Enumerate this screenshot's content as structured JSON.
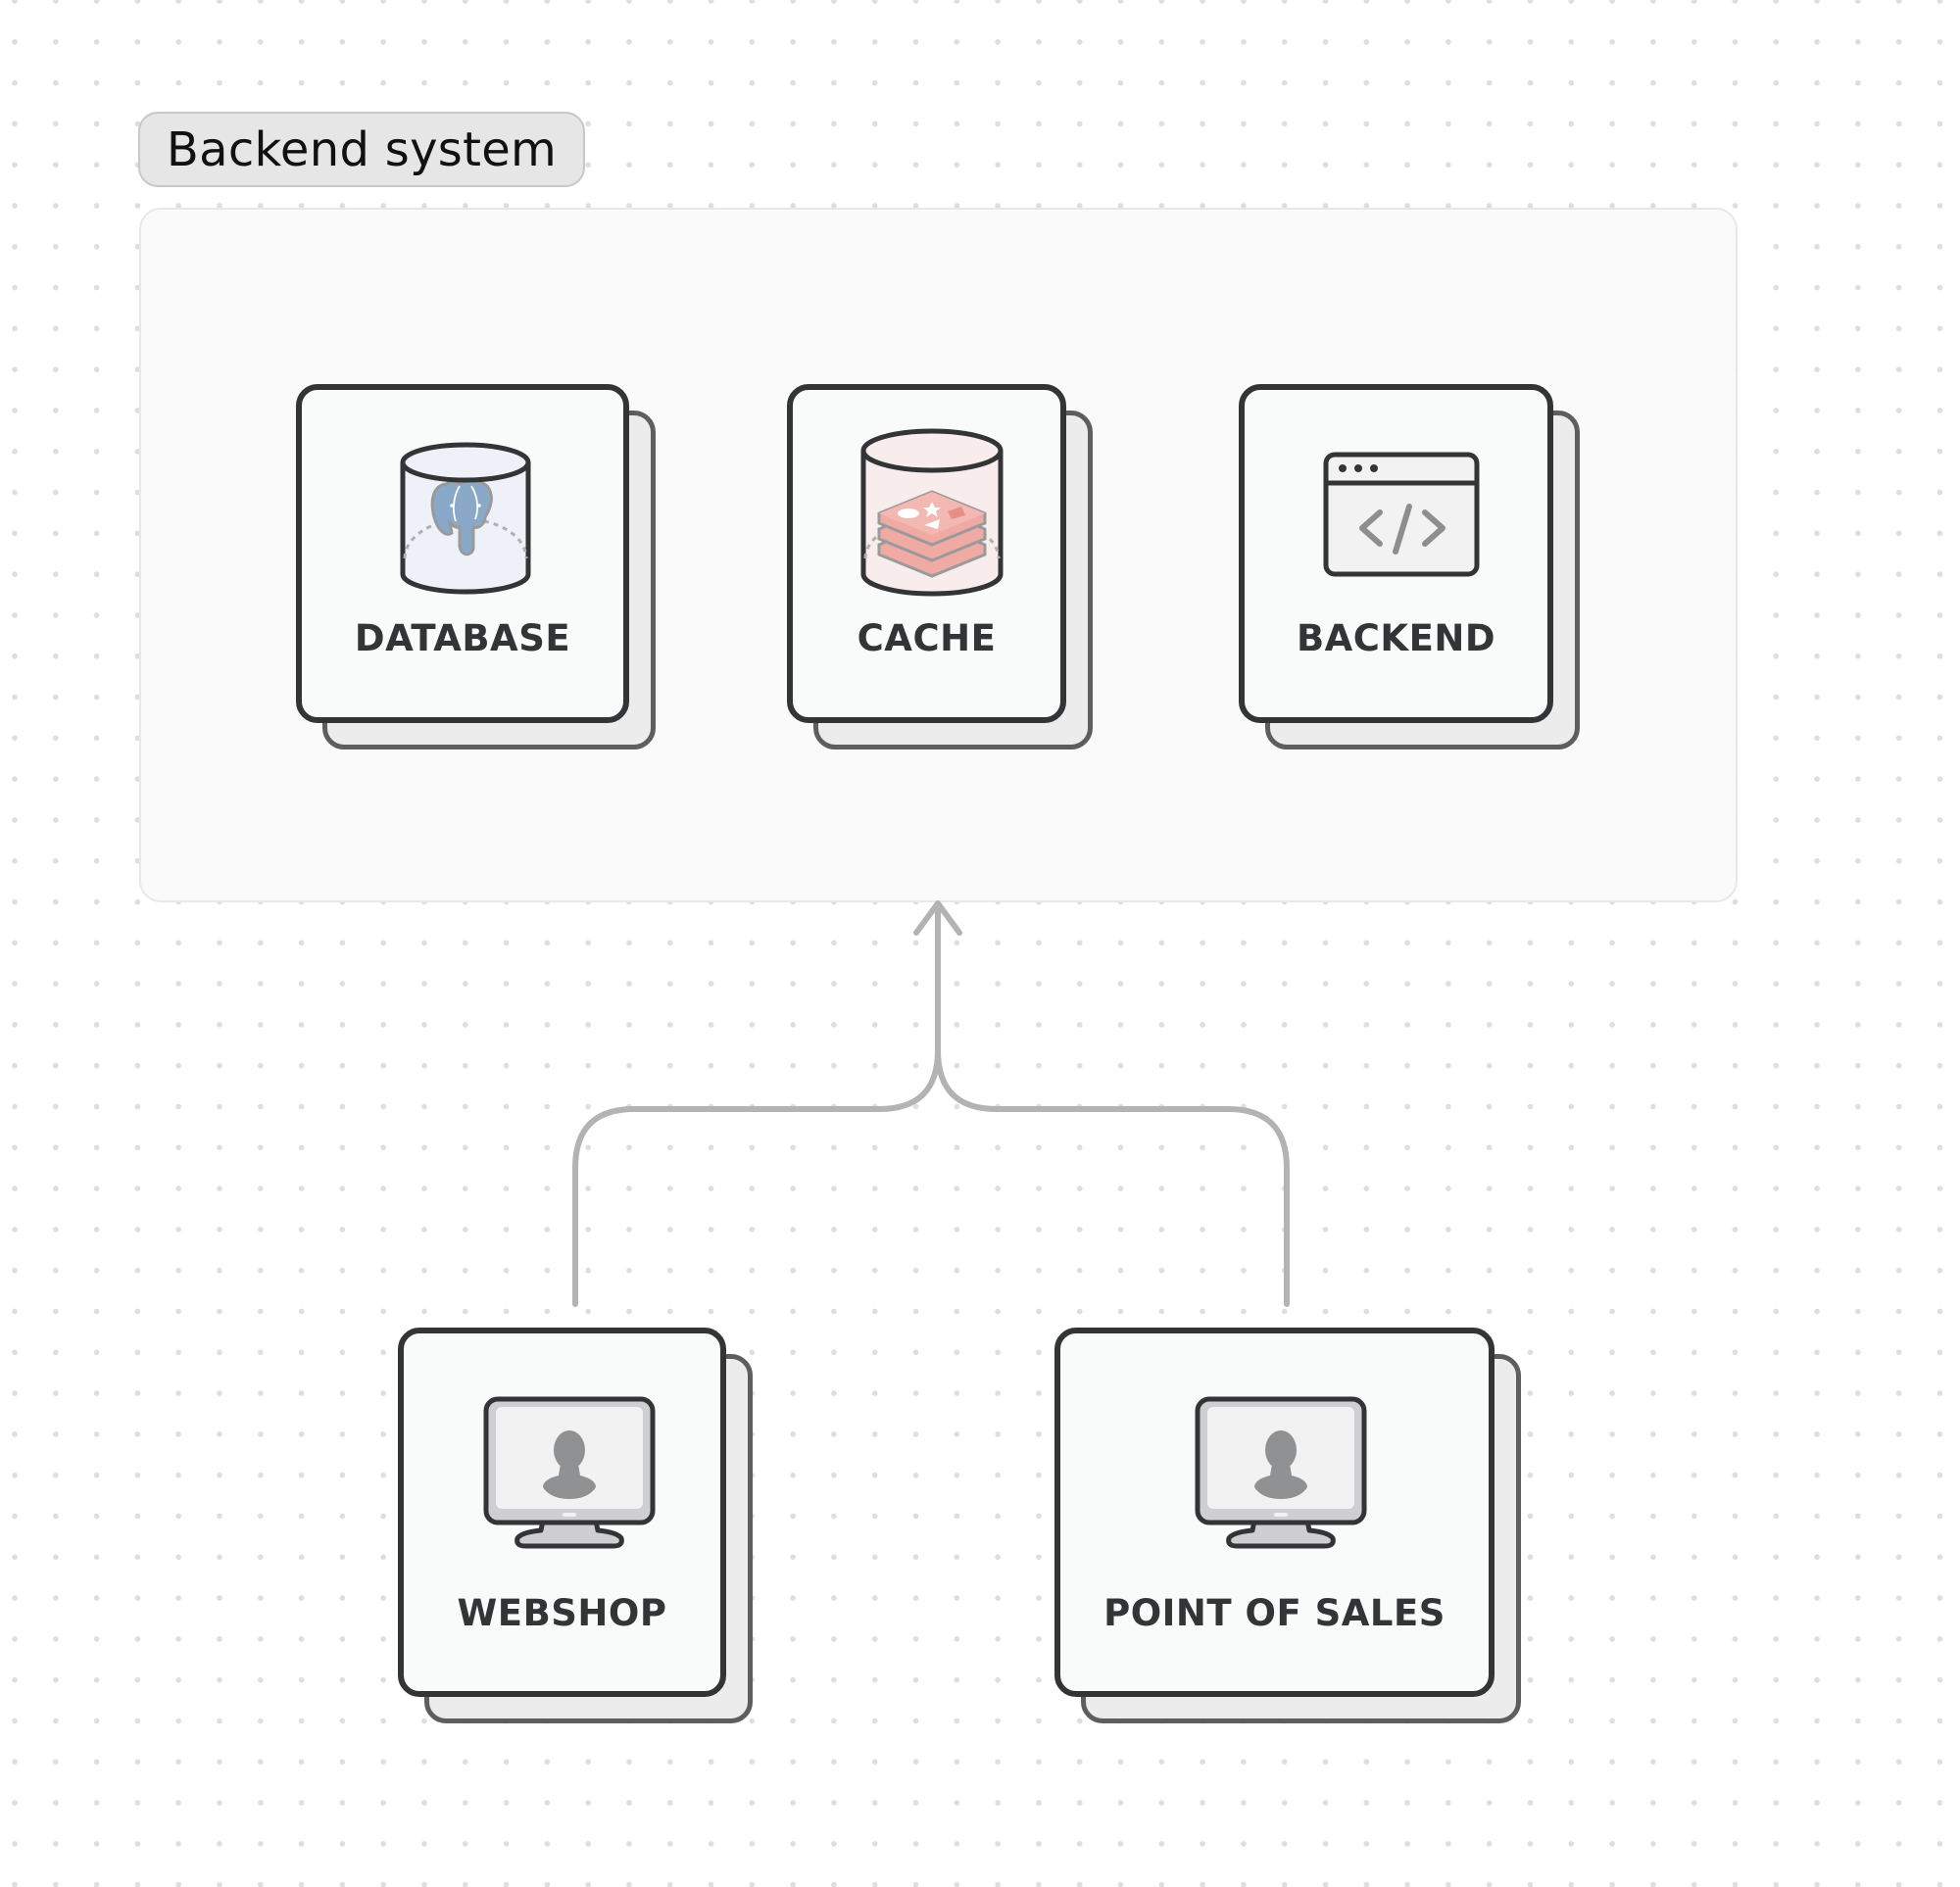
{
  "canvas": {
    "background": "#ffffff",
    "grid_dot_color": "#dedede"
  },
  "group": {
    "label": "Backend system",
    "nodes": [
      {
        "id": "database",
        "label": "DATABASE",
        "icon": "postgresql-database-icon",
        "accent": "#8aa8c8"
      },
      {
        "id": "cache",
        "label": "CACHE",
        "icon": "redis-cache-icon",
        "accent": "#f0aaa4"
      },
      {
        "id": "backend",
        "label": "BACKEND",
        "icon": "code-window-icon",
        "accent": "#8e8e8e"
      }
    ]
  },
  "clients": [
    {
      "id": "webshop",
      "label": "WEBSHOP",
      "icon": "user-monitor-icon"
    },
    {
      "id": "pos",
      "label": "POINT OF SALES",
      "icon": "user-monitor-icon"
    }
  ],
  "edges": [
    {
      "from": "webshop",
      "to": "Backend system",
      "style": "arrow"
    },
    {
      "from": "pos",
      "to": "Backend system",
      "style": "arrow"
    }
  ],
  "colors": {
    "card_border": "#333436",
    "card_back_border": "#5e5e60",
    "connector": "#b3b3b3"
  }
}
